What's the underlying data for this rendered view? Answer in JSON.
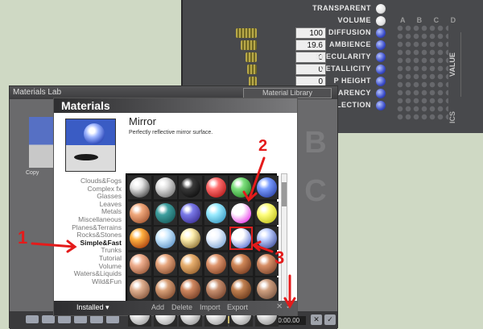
{
  "back_panel": {
    "channels": [
      {
        "label": "TRANSPARENT",
        "value": "",
        "dot": "white"
      },
      {
        "label": "VOLUME",
        "value": "",
        "dot": "white"
      },
      {
        "label": "DIFFUSION",
        "value": "100",
        "dot": "blue"
      },
      {
        "label": "AMBIENCE",
        "value": "19.6",
        "dot": "blue"
      },
      {
        "label": "SPECULARITY",
        "value": "0",
        "dot": "blue"
      },
      {
        "label": "METALLICITY",
        "value": "0",
        "dot": "blue"
      },
      {
        "label": "P HEIGHT",
        "value": "0",
        "dot": "blue"
      },
      {
        "label": "PARENCY",
        "value": "",
        "dot": "blue"
      },
      {
        "label": "FLECTION",
        "value": "",
        "dot": "blue"
      }
    ],
    "column_letters": "A B C D",
    "value_tab": "VALUE",
    "side_tab_2": "ICS"
  },
  "lab": {
    "title": "Materials Lab",
    "library_tab": "Material Library",
    "copy_label": "Copy",
    "bg_letters": "B C",
    "timecode": "00:00:00.00"
  },
  "dialog": {
    "title": "Materials",
    "material_name": "Mirror",
    "material_description": "Perfectly reflective mirror surface.",
    "categories": [
      "Clouds&Fogs",
      "Complex fx",
      "Glasses",
      "Leaves",
      "Metals",
      "Miscellaneous",
      "Planes&Terrains",
      "Rocks&Stones",
      "Simple&Fast",
      "Trunks",
      "Tutorial",
      "Volume",
      "Waters&Liquids",
      "Wild&Fun"
    ],
    "selected_category": "Simple&Fast",
    "selected_swatch_index": 16,
    "swatches": [
      [
        "#e6e6e6",
        "#1a1a1a"
      ],
      [
        "#e0e0e0",
        "#555555"
      ],
      [
        "#3a3a3a",
        "#000000"
      ],
      [
        "#ff7070",
        "#a00000"
      ],
      [
        "#7ee07e",
        "#107010"
      ],
      [
        "#7a9cff",
        "#14288c"
      ],
      [
        "#f0a87c",
        "#8c3e1c"
      ],
      [
        "#40a0a0",
        "#0a4848"
      ],
      [
        "#7a7ae8",
        "#2a1a7c"
      ],
      [
        "#9cecff",
        "#1c82b0"
      ],
      [
        "#ffffff",
        "#e000e0"
      ],
      [
        "#ffff80",
        "#b0b000"
      ],
      [
        "#ffb040",
        "#8c1c00"
      ],
      [
        "#d0ecff",
        "#3c78b4"
      ],
      [
        "#fff0b0",
        "#6c4c10"
      ],
      [
        "#f0f6ff",
        "#5a8cc8"
      ],
      [
        "#ffffff",
        "#2848c8"
      ],
      [
        "#c0d0ff",
        "#1c2c80"
      ],
      [
        "#f0b090",
        "#7c3c1c"
      ],
      [
        "#e8a880",
        "#6c3418"
      ],
      [
        "#e8b070",
        "#7c4818"
      ],
      [
        "#e09870",
        "#6c2c10"
      ],
      [
        "#d08858",
        "#5c2410"
      ],
      [
        "#d89068",
        "#64301a"
      ],
      [
        "#e0b090",
        "#6c3c24"
      ],
      [
        "#d8a078",
        "#643018"
      ],
      [
        "#d08860",
        "#582814"
      ],
      [
        "#c89070",
        "#5c2c18"
      ],
      [
        "#c08050",
        "#50240c"
      ],
      [
        "#d0a080",
        "#604030"
      ],
      [
        "#f0f0f0",
        "#888888"
      ],
      [
        "#f4f4f4",
        "#909090"
      ],
      [
        "#eeeeee",
        "#808080"
      ],
      [
        "#f2f2f2",
        "#8a8a8a"
      ],
      [
        "#f0f0f0",
        "#868686"
      ],
      [
        "#ececec",
        "#7c7c7c"
      ]
    ],
    "footer": {
      "installed": "Installed ▾",
      "add": "Add",
      "delete": "Delete",
      "import": "Import",
      "export": "Export",
      "close_glyph": "✕",
      "ok_glyph": "✓"
    }
  },
  "annotations": {
    "one": "1",
    "two": "2",
    "three": "3"
  }
}
